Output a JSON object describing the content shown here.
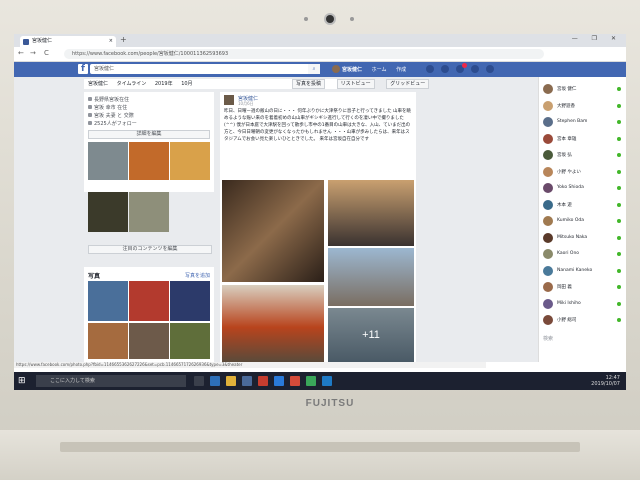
{
  "laptop": {
    "brand": "FUJITSU"
  },
  "browser": {
    "tab_title": "宮坂健仁",
    "tab_close": "×",
    "new_tab": "+",
    "window_controls": "— ❐ ✕",
    "back": "←",
    "forward": "→",
    "reload": "C",
    "url": "https://www.facebook.com/people/宮坂健仁/100011362593693"
  },
  "facebook": {
    "logo": "f",
    "search_placeholder": "宮坂健仁",
    "nav": {
      "profile_name": "宮坂健仁",
      "home": "ホーム",
      "create": "作成"
    },
    "subnav": {
      "name": "宮坂健仁",
      "timeline": "タイムライン",
      "year": "2019年",
      "month": "10月"
    },
    "subnav_right": {
      "add_friend": "写真を投稿",
      "list_view": "リストビュー",
      "grid_view": "グリッドビュー"
    },
    "intro": {
      "lines": [
        "長野県宮坂在住",
        "宮坂 幸市 在住",
        "宮坂 夫妻 と 交際",
        "2525人がフォロー"
      ],
      "edit_details": "詳細を編集",
      "edit_featured": "注目のコンテンツを編集"
    },
    "photos": {
      "title": "写真",
      "more": "写真を追加"
    },
    "post": {
      "author": "宮坂健仁",
      "date": "10月6日",
      "text": "昨日、日曜ー週の飯山の日に・・・ 何年ぶりかに大津祭りに息子と行ってきました 山車を眺めるような賑い来のを着着初めの山山車がギシギシ進行して行くのを凄い中で撮りました(^^) 僕が日本庭で大津駅を回って散歩し市中の1番目の山車は大きな、入山、ていまだ出の方と、今日日曜朝の変更がなくなったかもしれません ・・・山車が歩みしたらは、来年はスタジアムでお会い見た楽しいひとときでした。 来年は宮坂自在自分です",
      "more_count": "+11"
    },
    "chat_contacts": [
      "宮坂 健仁",
      "大野遊香",
      "Stephen Bam",
      "宮本 章雄",
      "宮坂 弘",
      "小野 やよい",
      "Yoko Shioda",
      "木本 遊",
      "Kumiko Oda",
      "Mitsuko Naka",
      "Kaori Ono",
      "Nanami Kaneko",
      "岡田 義",
      "Miki Ishiho",
      "小野 総司"
    ],
    "chat_search": "検索"
  },
  "status_bar": "https://www.facebook.com/photo.php?fbid=1146655362627226&set=pcb.1146657172626936&type=3&theater",
  "taskbar": {
    "search_placeholder": "ここに入力して検索",
    "time": "12:47",
    "date": "2019/10/07"
  },
  "colors": {
    "fb_blue": "#4267b2",
    "taskbar": "#1c2130",
    "bg": "#e9ebee"
  }
}
